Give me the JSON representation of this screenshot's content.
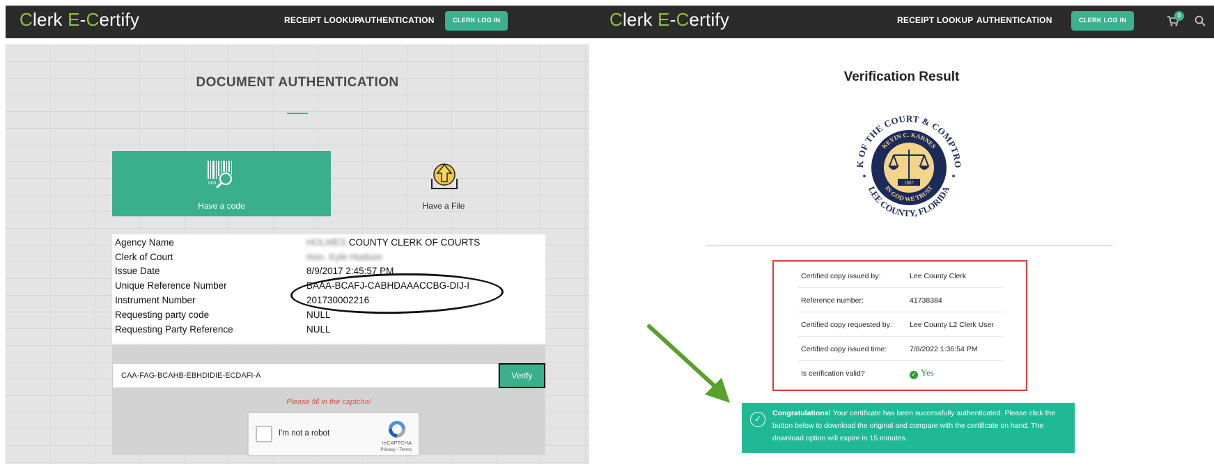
{
  "brand": {
    "c1": "C",
    "lerk": "lerk ",
    "e": "E",
    "dash": "-",
    "c2": "C",
    "ertify": "ertify"
  },
  "nav": {
    "receipt_lookup": "RECEIPT LOOKUP",
    "authentication": "AUTHENTICATION",
    "login": "CLERK LOG IN"
  },
  "cart": {
    "count": "0"
  },
  "left": {
    "title": "DOCUMENT AUTHENTICATION",
    "options": {
      "code": "Have a code",
      "file": "Have a File"
    },
    "info": [
      {
        "label": "Agency Name",
        "value_blur": "HOLMES",
        "value": " COUNTY CLERK OF COURTS"
      },
      {
        "label": "Clerk of Court",
        "value_blur": "Hon. Kyle Hudson",
        "value": ""
      },
      {
        "label": "Issue Date",
        "value_blur": "",
        "value": "8/9/2017 2:45:57 PM"
      },
      {
        "label": "Unique Reference Number",
        "value_blur": "",
        "value": "BAAA-BCAFJ-CABHDAAACCBG-DIJ-I"
      },
      {
        "label": "Instrument Number",
        "value_blur": "",
        "value": "201730002216"
      },
      {
        "label": "Requesting party code",
        "value_blur": "",
        "value": "NULL"
      },
      {
        "label": "Requesting Party Reference",
        "value_blur": "",
        "value": "NULL"
      }
    ],
    "code_value": "CAA-FAG-BCAHB-EBHDIDIE-ECDAFI-A",
    "verify": "Verify",
    "captcha_error": "Please fill in the captcha!",
    "recaptcha": {
      "label": "I'm not a robot",
      "brand": "reCAPTCHA",
      "links": "Privacy - Terms"
    }
  },
  "right": {
    "title": "Verification Result",
    "seal": {
      "outer_top": "CLERK OF THE COURT & COMPTROLLER",
      "inner_top": "KEVIN C. KARNES",
      "year": "1887",
      "motto": "IN GOD WE TRUST",
      "outer_bottom": "LEE COUNTY, FLORIDA"
    },
    "results": [
      {
        "key": "Certified copy issued by:",
        "value": "Lee County Clerk"
      },
      {
        "key": "Reference number:",
        "value": "41738384"
      },
      {
        "key": "Certified copy requested by:",
        "value": "Lee County L2 Clerk User"
      },
      {
        "key": "Certified copy issued time:",
        "value": "7/8/2022 1:36:54 PM"
      },
      {
        "key": "Is cerification valid?",
        "value": "Yes"
      }
    ],
    "congrats": {
      "bold": "Congratulations!",
      "text": " Your certificate has been successfully authenticated. Please click the button below to download the original and compare with the certificate on hand. The download option will expire in 15 minutes."
    }
  },
  "colors": {
    "accent": "#3ab18f",
    "topbar": "#2b2b2b",
    "logo_green": "#8cc63f",
    "alert_red": "#e23b3b",
    "success": "#1fba95"
  }
}
